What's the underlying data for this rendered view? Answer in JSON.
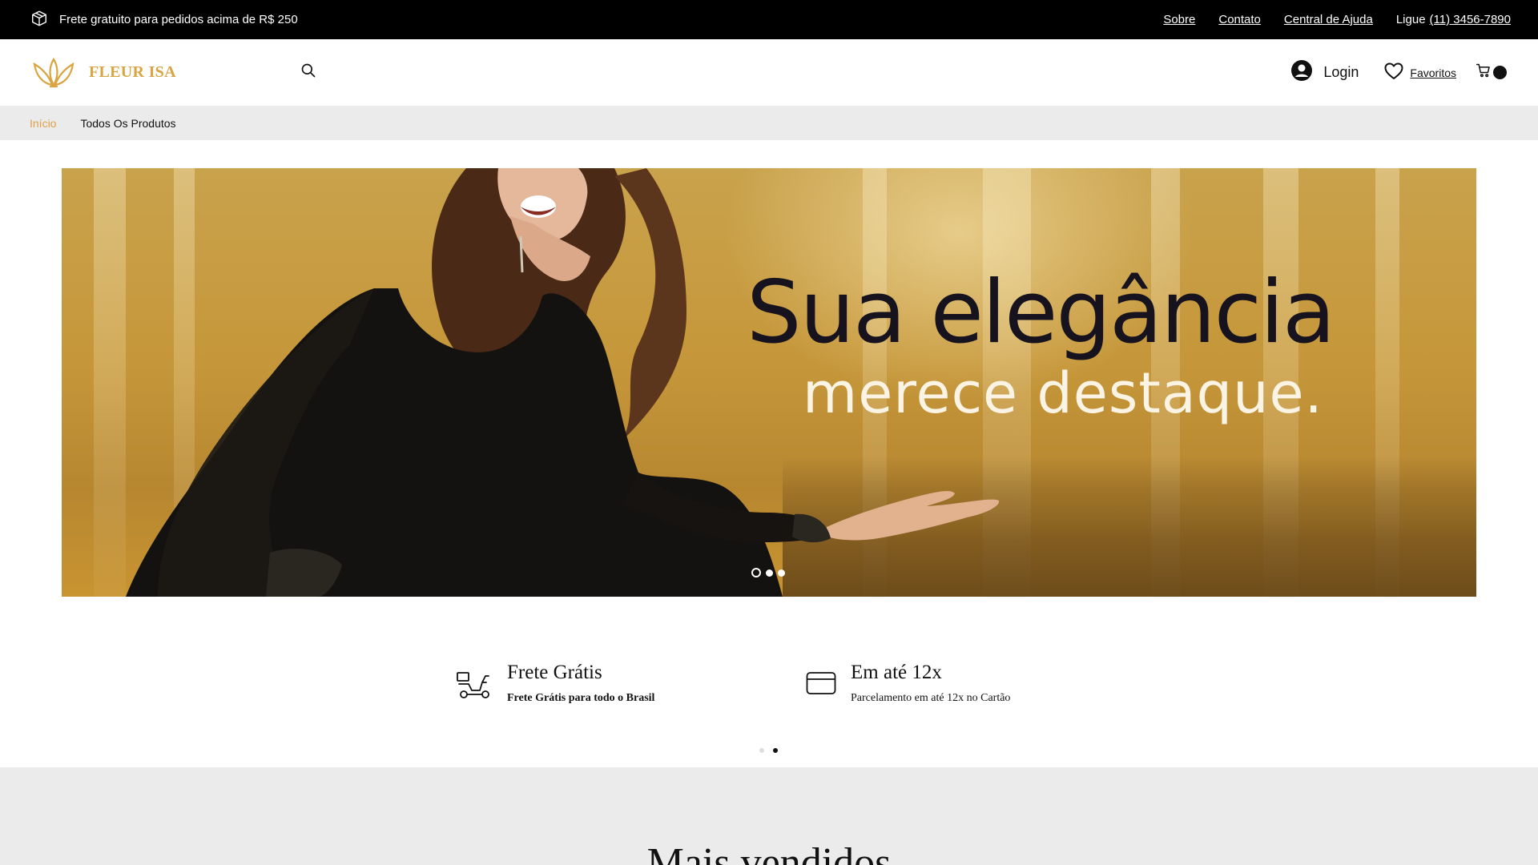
{
  "topbar": {
    "promo_icon": "package-icon",
    "promo_text": "Frete gratuito para pedidos acima de R$ 250",
    "links": {
      "about": "Sobre",
      "contact": "Contato",
      "help": "Central de Ajuda"
    },
    "call_label": "Ligue",
    "phone": "(11) 3456-7890"
  },
  "header": {
    "brand": "FLEUR ISA",
    "login_label": "Login",
    "favorites_label": "Favoritos"
  },
  "breadcrumb": {
    "home": "Início",
    "all_products": "Todos Os Produtos"
  },
  "hero": {
    "title_line1": "Sua elegância",
    "title_line2": "merece destaque.",
    "slides": 3,
    "active_slide": 1
  },
  "features": [
    {
      "icon": "delivery-scooter-icon",
      "title": "Frete Grátis",
      "subtitle": "Frete Grátis para todo o Brasil"
    },
    {
      "icon": "credit-card-icon",
      "title": "Em até 12x",
      "subtitle": "Parcelamento em até 12x no Cartão"
    }
  ],
  "features_pager": {
    "pages": 2,
    "active_page": 2
  },
  "best_sellers": {
    "title": "Mais vendidos"
  },
  "colors": {
    "brand_gold": "#d9a441",
    "breadcrumb_active": "#e0a046",
    "topbar_bg": "#000000",
    "section_bg": "#ebebeb"
  }
}
